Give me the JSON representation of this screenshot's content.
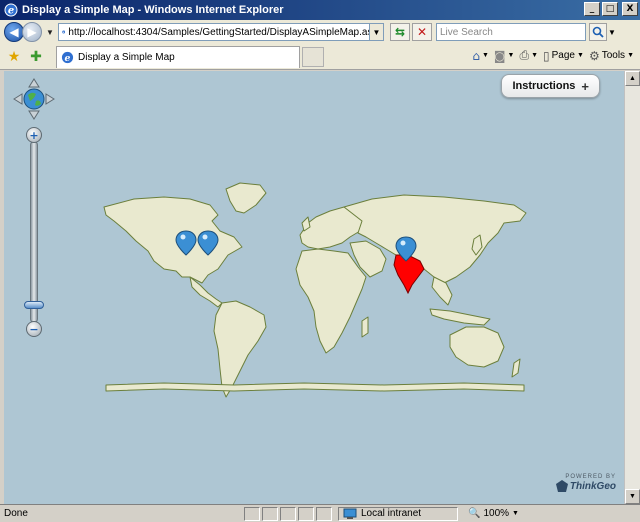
{
  "window": {
    "title": "Display a Simple Map - Windows Internet Explorer",
    "minimize_glyph": "_",
    "maximize_glyph": "□",
    "close_glyph": "X"
  },
  "addressbar": {
    "url": "http://localhost:4304/Samples/GettingStarted/DisplayASimpleMap.aspx",
    "search_placeholder": "Live Search"
  },
  "tabs": [
    {
      "label": "Display a Simple Map"
    }
  ],
  "commands": {
    "page_label": "Page",
    "tools_label": "Tools"
  },
  "map": {
    "instructions_label": "Instructions",
    "instructions_icon": "+",
    "powered_by": "POWERED BY",
    "brand": "ThinkGeo",
    "ocean_color": "#aec6d3",
    "land_color": "#e9e9cf",
    "border_color": "#6b7f3c",
    "highlight_country": "India",
    "highlight_color": "#ff0000",
    "markers": [
      "marker-1",
      "marker-2",
      "marker-3"
    ]
  },
  "status": {
    "text": "Done",
    "zone": "Local intranet",
    "zoom": "100%"
  }
}
